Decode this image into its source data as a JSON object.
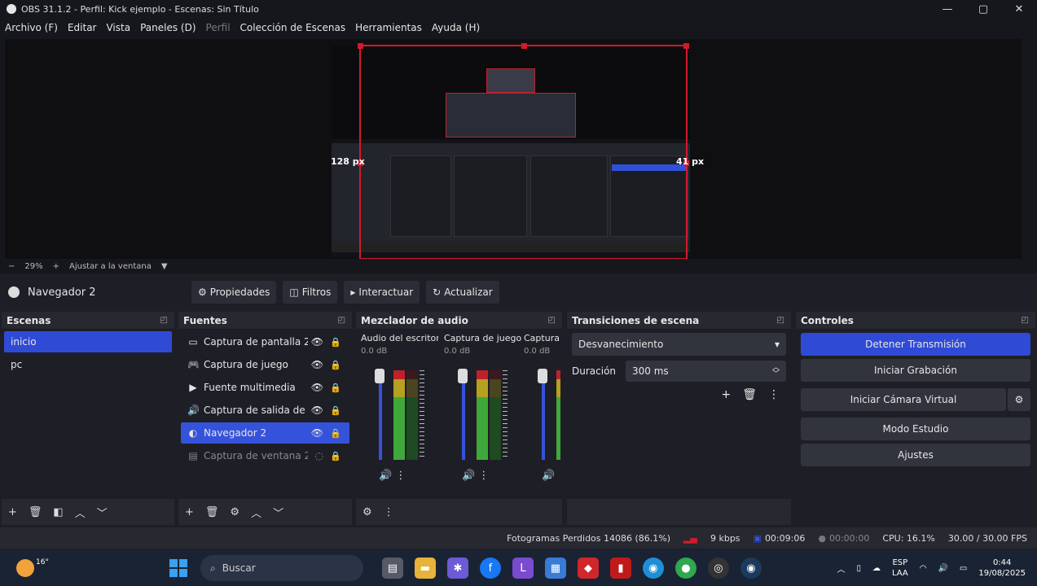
{
  "window": {
    "title": "OBS 31.1.2 - Perfil: Kick ejemplo - Escenas: Sin Título",
    "controls": [
      "—",
      "▢",
      "✕"
    ]
  },
  "menu": [
    {
      "label": "Archivo (F)",
      "disabled": false
    },
    {
      "label": "Editar",
      "disabled": false
    },
    {
      "label": "Vista",
      "disabled": false
    },
    {
      "label": "Paneles (D)",
      "disabled": false
    },
    {
      "label": "Perfil",
      "disabled": true
    },
    {
      "label": "Colección de Escenas",
      "disabled": false
    },
    {
      "label": "Herramientas",
      "disabled": false
    },
    {
      "label": "Ayuda (H)",
      "disabled": false
    }
  ],
  "preview": {
    "left_px_label": "128 px",
    "right_px_label": "41 px"
  },
  "zoom": {
    "minus": "−",
    "value": "29%",
    "plus": "+",
    "fit": "Ajustar a la ventana",
    "arrow": "▼"
  },
  "source_toolbar": {
    "source_name": "Navegador 2",
    "buttons": [
      {
        "icon": "⚙",
        "label": "Propiedades"
      },
      {
        "icon": "◫",
        "label": "Filtros"
      },
      {
        "icon": "▸",
        "label": "Interactuar"
      },
      {
        "icon": "↻",
        "label": "Actualizar"
      }
    ]
  },
  "scenes": {
    "title": "Escenas",
    "items": [
      {
        "label": "inicio",
        "selected": true
      },
      {
        "label": "pc",
        "selected": false
      }
    ],
    "footer": [
      "+",
      "🗑",
      "◧",
      "︿",
      "﹀"
    ]
  },
  "sources": {
    "title": "Fuentes",
    "items": [
      {
        "icon": "▭",
        "label": "Captura de pantalla 2",
        "state": "normal"
      },
      {
        "icon": "🎮",
        "label": "Captura de juego",
        "state": "normal"
      },
      {
        "icon": "▶",
        "label": "Fuente multimedia",
        "state": "normal"
      },
      {
        "icon": "🔊",
        "label": "Captura de salida de a…",
        "state": "normal"
      },
      {
        "icon": "◐",
        "label": "Navegador 2",
        "state": "selected"
      },
      {
        "icon": "▤",
        "label": "Captura de ventana 2",
        "state": "hidden"
      }
    ],
    "eye": "👁",
    "eye_off": "◌",
    "lock": "🔒",
    "footer": [
      "+",
      "🗑",
      "⚙",
      "︿",
      "﹀"
    ]
  },
  "mixer": {
    "title": "Mezclador de audio",
    "channels": [
      {
        "name": "Audio del escritorio",
        "db": "0.0 dB",
        "level": 0.9
      },
      {
        "name": "Captura de juego",
        "db": "0.0 dB",
        "level": 0.9
      },
      {
        "name": "Captura d",
        "db": "0.0 dB",
        "level": 0.9
      }
    ],
    "vol_icon": "🔊",
    "menu_icon": "⋮",
    "footer": [
      "⚙",
      "⋮"
    ]
  },
  "transitions": {
    "title": "Transiciones de escena",
    "selected": "Desvanecimiento",
    "duration_label": "Duración",
    "duration_value": "300 ms",
    "buttons": [
      "+",
      "🗑",
      "⋮"
    ]
  },
  "controls": {
    "title": "Controles",
    "buttons": [
      {
        "label": "Detener Transmisión",
        "primary": true
      },
      {
        "label": "Iniciar Grabación",
        "primary": false
      },
      {
        "label": "Iniciar Cámara Virtual",
        "primary": false
      },
      {
        "label": "Modo Estudio",
        "primary": false
      },
      {
        "label": "Ajustes",
        "primary": false
      }
    ],
    "vcam_settings_icon": "⚙"
  },
  "status": {
    "dropped": "Fotogramas Perdidos 14086 (86.1%)",
    "bitrate": "9 kbps",
    "stream_time": "00:09:06",
    "rec_time": "00:00:00",
    "cpu": "CPU: 16.1%",
    "fps": "30.00 / 30.00 FPS"
  },
  "taskbar": {
    "temp": "16°",
    "search": "Buscar",
    "apps": [
      {
        "name": "taskview-icon",
        "glyph": "▤",
        "color": "#555a66"
      },
      {
        "name": "folder-icon",
        "glyph": "▬",
        "color": "#e8b33a"
      },
      {
        "name": "teams-icon",
        "glyph": "✱",
        "color": "#6b5bd6"
      },
      {
        "name": "facebook-icon",
        "glyph": "f",
        "color": "#1877f2"
      },
      {
        "name": "app-l-icon",
        "glyph": "L",
        "color": "#7a4bd0"
      },
      {
        "name": "store-icon",
        "glyph": "▦",
        "color": "#3a7bd5"
      },
      {
        "name": "shield-icon",
        "glyph": "◆",
        "color": "#d0262c"
      },
      {
        "name": "pdf-icon",
        "glyph": "▮",
        "color": "#c01a1a"
      },
      {
        "name": "edge-icon",
        "glyph": "◉",
        "color": "#1e8fd6"
      },
      {
        "name": "chrome-icon",
        "glyph": "●",
        "color": "#2fa84f"
      },
      {
        "name": "obs-icon",
        "glyph": "◎",
        "color": "#333"
      },
      {
        "name": "steam-icon",
        "glyph": "◉",
        "color": "#1b3a5c"
      }
    ],
    "lang": "ESP",
    "lang2": "LAA",
    "time": "0:44",
    "date": "19/08/2025"
  }
}
